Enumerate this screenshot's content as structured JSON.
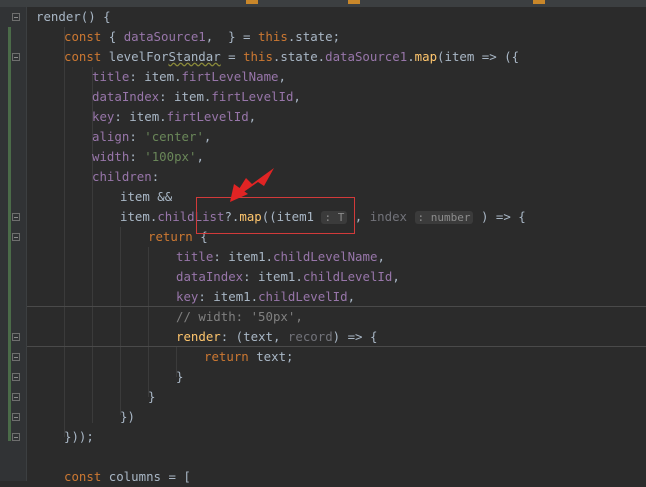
{
  "editor": {
    "lines": [
      {
        "indent": 0,
        "tokens": [
          [
            "t",
            "render() {"
          ]
        ]
      },
      {
        "indent": 1,
        "tokens": [
          [
            "kw",
            "const "
          ],
          [
            "t",
            "{ "
          ],
          [
            "prop",
            "dataSource1"
          ],
          [
            "t",
            ",  } = "
          ],
          [
            "kw",
            "this"
          ],
          [
            "t",
            ".state;"
          ]
        ]
      },
      {
        "indent": 1,
        "tokens": [
          [
            "kw",
            "const "
          ],
          [
            "t",
            "levelFor"
          ],
          [
            "u",
            "Standar"
          ],
          [
            "t",
            " = "
          ],
          [
            "kw",
            "this"
          ],
          [
            "t",
            ".state."
          ],
          [
            "prop",
            "dataSource1"
          ],
          [
            "t",
            "."
          ],
          [
            "fn",
            "map"
          ],
          [
            "t",
            "(item => ({"
          ]
        ]
      },
      {
        "indent": 2,
        "tokens": [
          [
            "prop",
            "title"
          ],
          [
            "t",
            ": item."
          ],
          [
            "prop",
            "firtLevelName"
          ],
          [
            "t",
            ","
          ]
        ]
      },
      {
        "indent": 2,
        "tokens": [
          [
            "prop",
            "dataIndex"
          ],
          [
            "t",
            ": item."
          ],
          [
            "prop",
            "firtLevelId"
          ],
          [
            "t",
            ","
          ]
        ]
      },
      {
        "indent": 2,
        "tokens": [
          [
            "prop",
            "key"
          ],
          [
            "t",
            ": item."
          ],
          [
            "prop",
            "firtLevelId"
          ],
          [
            "t",
            ","
          ]
        ]
      },
      {
        "indent": 2,
        "tokens": [
          [
            "prop",
            "align"
          ],
          [
            "t",
            ": "
          ],
          [
            "str",
            "'center'"
          ],
          [
            "t",
            ","
          ]
        ]
      },
      {
        "indent": 2,
        "tokens": [
          [
            "prop",
            "width"
          ],
          [
            "t",
            ": "
          ],
          [
            "str",
            "'100px'"
          ],
          [
            "t",
            ","
          ]
        ]
      },
      {
        "indent": 2,
        "tokens": [
          [
            "prop",
            "children"
          ],
          [
            "t",
            ":"
          ]
        ]
      },
      {
        "indent": 3,
        "tokens": [
          [
            "t",
            "item &&"
          ]
        ]
      },
      {
        "indent": 3,
        "tokens": [
          [
            "t",
            "item."
          ],
          [
            "prop",
            "childList"
          ],
          [
            "t",
            "?."
          ],
          [
            "fn",
            "map"
          ],
          [
            "t",
            "((item1 "
          ],
          [
            "hint",
            ": T"
          ],
          [
            "t",
            " , "
          ],
          [
            "dim",
            "index"
          ],
          [
            "t",
            " "
          ],
          [
            "hint",
            ": number"
          ],
          [
            "t",
            " ) => {"
          ]
        ]
      },
      {
        "indent": 4,
        "tokens": [
          [
            "kw",
            "return "
          ],
          [
            "t",
            "{"
          ]
        ]
      },
      {
        "indent": 5,
        "tokens": [
          [
            "prop",
            "title"
          ],
          [
            "t",
            ": item1."
          ],
          [
            "prop",
            "childLevelName"
          ],
          [
            "t",
            ","
          ]
        ]
      },
      {
        "indent": 5,
        "tokens": [
          [
            "prop",
            "dataIndex"
          ],
          [
            "t",
            ": item1."
          ],
          [
            "prop",
            "childLevelId"
          ],
          [
            "t",
            ","
          ]
        ]
      },
      {
        "indent": 5,
        "tokens": [
          [
            "prop",
            "key"
          ],
          [
            "t",
            ": item1."
          ],
          [
            "prop",
            "childLevelId"
          ],
          [
            "t",
            ","
          ]
        ]
      },
      {
        "indent": 5,
        "tokens": [
          [
            "cmt",
            "// width: '50px',"
          ]
        ]
      },
      {
        "indent": 5,
        "tokens": [
          [
            "fn",
            "render"
          ],
          [
            "t",
            ": (text, "
          ],
          [
            "dim",
            "record"
          ],
          [
            "t",
            ") => {"
          ]
        ]
      },
      {
        "indent": 6,
        "tokens": [
          [
            "kw",
            "return "
          ],
          [
            "t",
            "text;"
          ]
        ]
      },
      {
        "indent": 5,
        "tokens": [
          [
            "t",
            "}"
          ]
        ]
      },
      {
        "indent": 4,
        "tokens": [
          [
            "t",
            "}"
          ]
        ]
      },
      {
        "indent": 3,
        "tokens": [
          [
            "t",
            "})"
          ]
        ]
      },
      {
        "indent": 1,
        "tokens": [
          [
            "t",
            "}));"
          ]
        ]
      },
      {
        "indent": 0,
        "tokens": []
      },
      {
        "indent": 1,
        "tokens": [
          [
            "kw",
            "const "
          ],
          [
            "t",
            "columns = ["
          ]
        ]
      }
    ]
  },
  "colors": {
    "background": "#2b2b2b",
    "keyword": "#cc7832",
    "property": "#9876aa",
    "function": "#ffc66d",
    "string": "#6a8759",
    "comment": "#808080",
    "annotation": "#e02424"
  },
  "annotations": {
    "box_icon": "highlight-rectangle",
    "arrow_icon": "red-arrow-icon"
  }
}
